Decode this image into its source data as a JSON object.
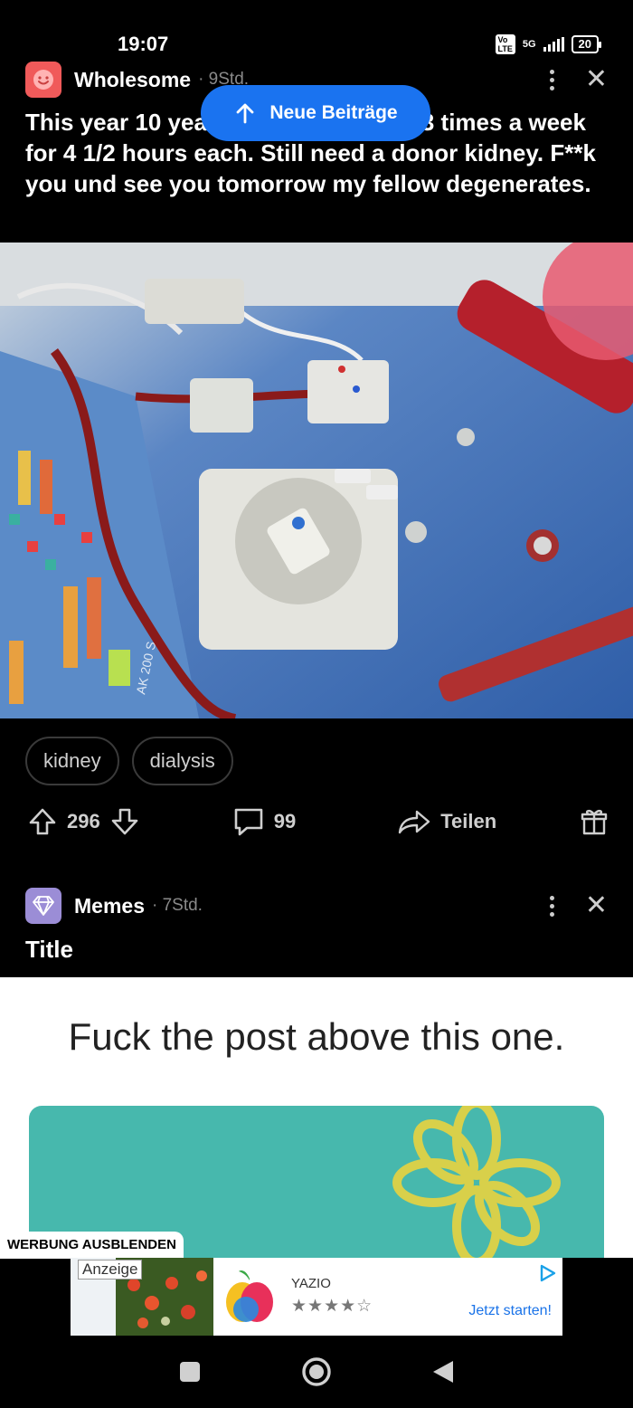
{
  "status_bar": {
    "time": "19:07",
    "volte": "Vo\nLTE",
    "network": "5G",
    "battery": "20"
  },
  "new_posts_pill": {
    "label": "Neue Beiträge"
  },
  "post1": {
    "community": "Wholesome",
    "age": "· 9Std.",
    "title": "This year 10 years on the machine. 3 times a week for 4 1/2 hours each. Still need a donor kidney. F**k you und see you tomorrow my fellow degenerates.",
    "photo_label": "AK 200 S",
    "tags": [
      "kidney",
      "dialysis"
    ],
    "upvotes": "296",
    "comments": "99",
    "share_label": "Teilen"
  },
  "post2": {
    "community": "Memes",
    "age": "· 7Std.",
    "title": "Title",
    "meme_caption": "Fuck the post above this one."
  },
  "ads": {
    "hide_label": "WERBUNG AUSBLENDEN",
    "anzeige_label": "Anzeige",
    "app_name": "YAZIO",
    "rating": "★★★★☆",
    "cta": "Jetzt starten!"
  },
  "colors": {
    "pill_blue": "#1a73f0",
    "wholesome_icon": "#f05a5a",
    "memes_icon": "#9b8dd6",
    "ad_link": "#1a73e8"
  }
}
